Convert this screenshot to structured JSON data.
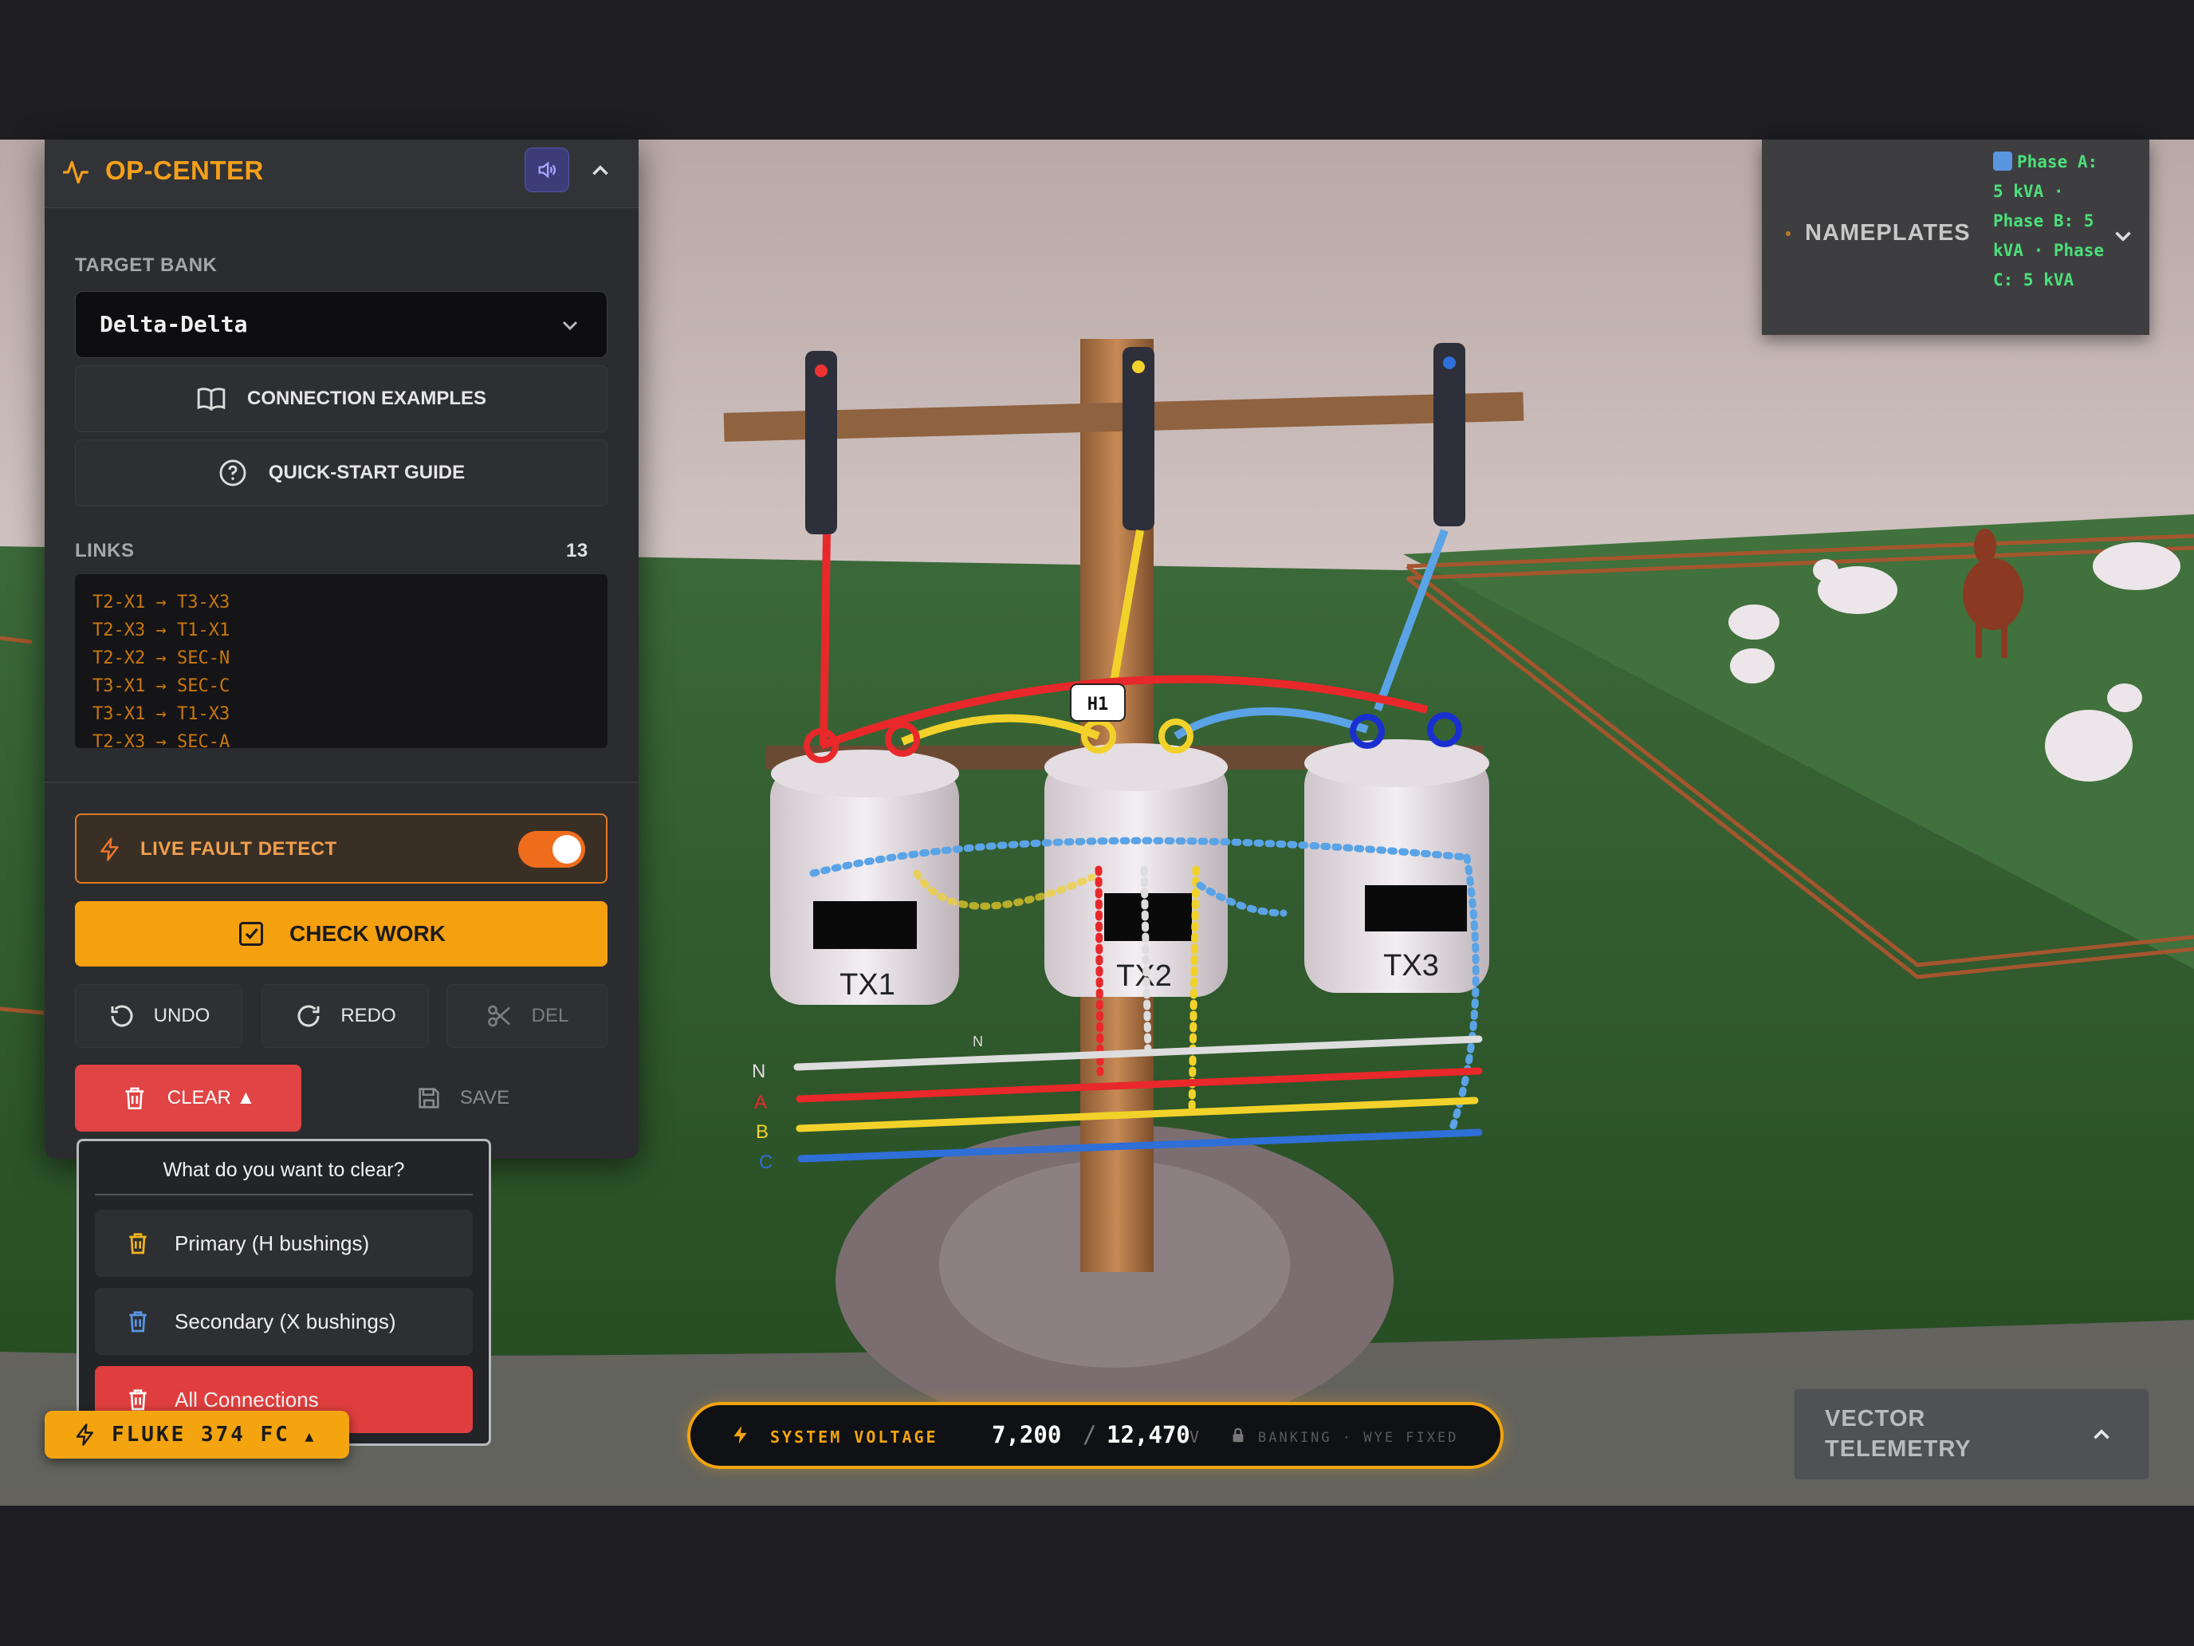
{
  "op_center": {
    "title": "OP-CENTER",
    "target_bank_label": "TARGET BANK",
    "target_bank_value": "Delta-Delta",
    "connection_examples": "CONNECTION EXAMPLES",
    "quick_start": "QUICK-START GUIDE",
    "links_label": "LINKS",
    "links_count": "13",
    "links": [
      "T2-X1 → T3-X3",
      "T2-X3 → T1-X1",
      "T2-X2 → SEC-N",
      "T3-X1 → SEC-C",
      "T3-X1 → T1-X3",
      "T2-X3 → SEC-A"
    ],
    "live_fault": "LIVE FAULT DETECT",
    "live_fault_on": true,
    "check_work": "CHECK WORK",
    "undo": "UNDO",
    "redo": "REDO",
    "del": "DEL",
    "clear": "CLEAR",
    "save": "SAVE"
  },
  "clear_menu": {
    "question": "What do you want to clear?",
    "primary": "Primary (H bushings)",
    "secondary": "Secondary (X bushings)",
    "all": "All Connections"
  },
  "fluke": {
    "label": "FLUKE 374 FC"
  },
  "voltage": {
    "label": "SYSTEM VOLTAGE",
    "primary": "7,200",
    "slash": "/",
    "secondary": "12,470",
    "unit": "V",
    "banking": "BANKING · WYE FIXED"
  },
  "nameplates": {
    "title": "NAMEPLATES",
    "detail": "Phase A: 5 kVA · Phase B: 5 kVA · Phase C: 5 kVA"
  },
  "vector_telemetry": {
    "title": "VECTOR TELEMETRY"
  },
  "scene": {
    "transformers": [
      "TX1",
      "TX2",
      "TX3"
    ],
    "bushing_tag": "H1",
    "bus_labels": [
      "N",
      "A",
      "B",
      "C"
    ],
    "neutral_tag": "N"
  },
  "colors": {
    "accent": "#f5a00f",
    "danger": "#e04444",
    "phase_a": "#e8282a",
    "phase_b": "#f2d22a",
    "phase_c": "#2f6fd8",
    "neutral": "#dddddd"
  }
}
